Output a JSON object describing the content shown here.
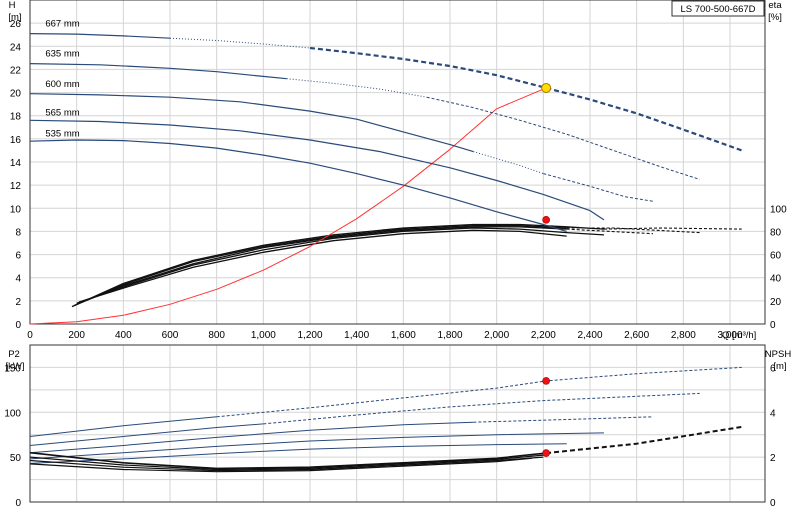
{
  "chart_data": [
    {
      "type": "line",
      "title": "LS 700-500-667D",
      "xlabel": "Q [m³/h]",
      "ylabel_left": [
        "H",
        "[m]"
      ],
      "ylabel_right": [
        "eta",
        "[%]"
      ],
      "xlim": [
        0,
        3150
      ],
      "ylim": [
        0,
        28
      ],
      "ylim_right": [
        0,
        280
      ],
      "grid": true,
      "x_ticks": [
        0,
        200,
        400,
        600,
        800,
        1000,
        1200,
        1400,
        1600,
        1800,
        2000,
        2200,
        2400,
        2600,
        2800,
        3000
      ],
      "x_tick_labels": [
        "0",
        "200",
        "400",
        "600",
        "800",
        "1,000",
        "1,200",
        "1,400",
        "1,600",
        "1,800",
        "2,000",
        "2,200",
        "2,400",
        "2,600",
        "2,800",
        "3,000"
      ],
      "y_ticks": [
        0,
        2,
        4,
        6,
        8,
        10,
        12,
        14,
        16,
        18,
        20,
        22,
        24,
        26
      ],
      "y_ticks_right": [
        0,
        20,
        40,
        60,
        80,
        100
      ],
      "head_curves": [
        {
          "name": "667 mm",
          "label_at": [
            10,
            25.7
          ],
          "solid": [
            [
              0,
              25.1
            ],
            [
              200,
              25.05
            ],
            [
              400,
              24.9
            ],
            [
              600,
              24.7
            ]
          ],
          "dotted": [
            [
              600,
              24.7
            ],
            [
              800,
              24.5
            ],
            [
              1000,
              24.2
            ],
            [
              1200,
              23.85
            ]
          ],
          "dashed": [
            [
              1200,
              23.85
            ],
            [
              1400,
              23.4
            ],
            [
              1600,
              22.9
            ],
            [
              1800,
              22.3
            ],
            [
              2000,
              21.5
            ],
            [
              2212,
              20.4
            ],
            [
              2400,
              19.4
            ],
            [
              2600,
              18.2
            ],
            [
              2800,
              16.8
            ],
            [
              3050,
              15.0
            ]
          ]
        },
        {
          "name": "635 mm",
          "label_at": [
            10,
            23.1
          ],
          "solid": [
            [
              0,
              22.5
            ],
            [
              300,
              22.4
            ],
            [
              600,
              22.1
            ],
            [
              800,
              21.8
            ],
            [
              1000,
              21.4
            ],
            [
              1100,
              21.2
            ]
          ],
          "dotted": [
            [
              1100,
              21.2
            ],
            [
              1300,
              20.8
            ],
            [
              1500,
              20.3
            ],
            [
              1700,
              19.6
            ]
          ],
          "dashed": [
            [
              1700,
              19.6
            ],
            [
              1900,
              18.7
            ],
            [
              2100,
              17.6
            ],
            [
              2300,
              16.4
            ],
            [
              2500,
              15.0
            ],
            [
              2700,
              13.6
            ],
            [
              2870,
              12.5
            ]
          ]
        },
        {
          "name": "600 mm",
          "label_at": [
            10,
            20.5
          ],
          "solid": [
            [
              0,
              19.9
            ],
            [
              300,
              19.8
            ],
            [
              600,
              19.6
            ],
            [
              900,
              19.2
            ],
            [
              1200,
              18.4
            ],
            [
              1400,
              17.7
            ],
            [
              1600,
              16.6
            ],
            [
              1800,
              15.5
            ],
            [
              1900,
              14.9
            ]
          ],
          "dotted": [
            [
              1900,
              14.9
            ],
            [
              2100,
              13.7
            ],
            [
              2200,
              13.0
            ]
          ],
          "dashed": [
            [
              2200,
              13.0
            ],
            [
              2400,
              11.9
            ],
            [
              2550,
              11.0
            ],
            [
              2670,
              10.6
            ]
          ]
        },
        {
          "name": "565 mm",
          "label_at": [
            10,
            18.0
          ],
          "solid": [
            [
              0,
              17.6
            ],
            [
              300,
              17.5
            ],
            [
              600,
              17.2
            ],
            [
              900,
              16.7
            ],
            [
              1200,
              15.9
            ],
            [
              1500,
              14.9
            ],
            [
              1800,
              13.5
            ],
            [
              2000,
              12.4
            ],
            [
              2200,
              11.2
            ],
            [
              2400,
              9.8
            ],
            [
              2460,
              9.0
            ]
          ],
          "dotted": [],
          "dashed": []
        },
        {
          "name": "535 mm",
          "label_at": [
            10,
            16.2
          ],
          "solid": [
            [
              0,
              15.8
            ],
            [
              200,
              15.9
            ],
            [
              400,
              15.85
            ],
            [
              600,
              15.6
            ],
            [
              800,
              15.2
            ],
            [
              1000,
              14.6
            ],
            [
              1200,
              13.9
            ],
            [
              1400,
              13.0
            ],
            [
              1600,
              12.0
            ],
            [
              1800,
              10.9
            ],
            [
              2000,
              9.7
            ],
            [
              2200,
              8.6
            ],
            [
              2300,
              8.0
            ]
          ],
          "dotted": [],
          "dashed": []
        }
      ],
      "eta_curves": [
        {
          "solid": [
            [
              180,
              15
            ],
            [
              400,
              35
            ],
            [
              700,
              55
            ],
            [
              1000,
              68
            ],
            [
              1300,
              77
            ],
            [
              1600,
              83
            ],
            [
              1900,
              86
            ],
            [
              2100,
              86
            ],
            [
              2300,
              84
            ],
            [
              2460,
              82
            ]
          ],
          "dashed": [
            [
              2460,
              82
            ],
            [
              2700,
              83
            ],
            [
              3050,
              82
            ]
          ]
        },
        {
          "solid": [
            [
              190,
              16
            ],
            [
              400,
              34
            ],
            [
              700,
              54
            ],
            [
              1000,
              67
            ],
            [
              1300,
              76
            ],
            [
              1600,
              82
            ],
            [
              1900,
              85
            ],
            [
              2100,
              85
            ],
            [
              2300,
              83
            ]
          ],
          "dashed": [
            [
              2300,
              83
            ],
            [
              2500,
              83
            ],
            [
              2870,
              79
            ]
          ]
        },
        {
          "solid": [
            [
              200,
              17
            ],
            [
              400,
              33
            ],
            [
              700,
              52
            ],
            [
              1000,
              66
            ],
            [
              1300,
              75
            ],
            [
              1600,
              81
            ],
            [
              1900,
              84
            ],
            [
              2100,
              84
            ],
            [
              2300,
              82
            ]
          ],
          "dashed": [
            [
              2300,
              82
            ],
            [
              2670,
              78
            ]
          ]
        },
        {
          "solid": [
            [
              200,
              18
            ],
            [
              400,
              32
            ],
            [
              700,
              51
            ],
            [
              1000,
              64
            ],
            [
              1300,
              74
            ],
            [
              1600,
              80
            ],
            [
              1900,
              83
            ],
            [
              2100,
              82
            ],
            [
              2300,
              79
            ],
            [
              2460,
              77
            ]
          ],
          "dashed": []
        },
        {
          "solid": [
            [
              210,
              19
            ],
            [
              400,
              31
            ],
            [
              700,
              49
            ],
            [
              1000,
              62
            ],
            [
              1300,
              72
            ],
            [
              1600,
              78
            ],
            [
              1900,
              81
            ],
            [
              2100,
              80
            ],
            [
              2300,
              76
            ]
          ],
          "dashed": []
        }
      ],
      "system_curve": [
        [
          0,
          0
        ],
        [
          200,
          0.2
        ],
        [
          400,
          0.75
        ],
        [
          600,
          1.7
        ],
        [
          800,
          3.0
        ],
        [
          1000,
          4.65
        ],
        [
          1200,
          6.7
        ],
        [
          1400,
          9.1
        ],
        [
          1600,
          11.9
        ],
        [
          1800,
          15.1
        ],
        [
          2000,
          18.6
        ],
        [
          2212,
          20.4
        ]
      ],
      "duty_point": {
        "q": 2212,
        "h": 20.4
      },
      "eta_point": {
        "q": 2212,
        "eta": 90
      }
    },
    {
      "type": "line",
      "ylabel_left": [
        "P2",
        "[kW]"
      ],
      "ylabel_right": [
        "NPSH",
        "[m]"
      ],
      "xlim": [
        0,
        3150
      ],
      "ylim": [
        0,
        175
      ],
      "ylim_right": [
        0,
        7
      ],
      "grid": true,
      "y_ticks": [
        0,
        50,
        100,
        150
      ],
      "y_ticks_right": [
        0,
        2,
        4,
        6
      ],
      "power_curves": [
        {
          "solid": [
            [
              0,
              73
            ],
            [
              400,
              85
            ],
            [
              800,
              95
            ]
          ],
          "dashed": [
            [
              800,
              95
            ],
            [
              1200,
              105
            ],
            [
              1600,
              116
            ],
            [
              2000,
              127
            ],
            [
              2212,
              135
            ],
            [
              2600,
              143
            ],
            [
              3050,
              150
            ]
          ]
        },
        {
          "solid": [
            [
              0,
              63
            ],
            [
              400,
              73
            ],
            [
              800,
              83
            ],
            [
              1000,
              87
            ]
          ],
          "dashed": [
            [
              1000,
              87
            ],
            [
              1400,
              97
            ],
            [
              1800,
              106
            ],
            [
              2200,
              113
            ],
            [
              2870,
              121
            ]
          ]
        },
        {
          "solid": [
            [
              0,
              55
            ],
            [
              400,
              63
            ],
            [
              800,
              72
            ],
            [
              1200,
              80
            ],
            [
              1600,
              86
            ],
            [
              1900,
              89
            ]
          ],
          "dashed": [
            [
              1900,
              89
            ],
            [
              2300,
              92
            ],
            [
              2670,
              95
            ]
          ]
        },
        {
          "solid": [
            [
              0,
              48
            ],
            [
              400,
              55
            ],
            [
              800,
              62
            ],
            [
              1200,
              68
            ],
            [
              1600,
              72
            ],
            [
              2000,
              75
            ],
            [
              2460,
              77
            ]
          ],
          "dashed": []
        },
        {
          "solid": [
            [
              0,
              43
            ],
            [
              400,
              48
            ],
            [
              800,
              54
            ],
            [
              1200,
              59
            ],
            [
              1600,
              62
            ],
            [
              2000,
              64
            ],
            [
              2300,
              65
            ]
          ],
          "dashed": []
        }
      ],
      "npsh_curves": [
        {
          "solid": [
            [
              0,
              2.2
            ],
            [
              400,
              1.75
            ],
            [
              800,
              1.5
            ],
            [
              1200,
              1.55
            ],
            [
              1600,
              1.75
            ],
            [
              2000,
              1.95
            ],
            [
              2212,
              2.18
            ]
          ],
          "dashed": [
            [
              2212,
              2.18
            ],
            [
              2600,
              2.6
            ],
            [
              3050,
              3.35
            ]
          ]
        },
        {
          "solid": [
            [
              0,
              2.0
            ],
            [
              400,
              1.65
            ],
            [
              800,
              1.45
            ],
            [
              1200,
              1.5
            ],
            [
              1600,
              1.7
            ],
            [
              2000,
              1.9
            ],
            [
              2212,
              2.1
            ]
          ],
          "dashed": []
        },
        {
          "solid": [
            [
              0,
              1.85
            ],
            [
              400,
              1.55
            ],
            [
              800,
              1.4
            ],
            [
              1200,
              1.45
            ],
            [
              1600,
              1.65
            ],
            [
              2000,
              1.85
            ],
            [
              2200,
              2.0
            ]
          ],
          "dashed": []
        },
        {
          "solid": [
            [
              0,
              1.7
            ],
            [
              400,
              1.45
            ],
            [
              800,
              1.35
            ],
            [
              1200,
              1.4
            ],
            [
              1600,
              1.6
            ],
            [
              2000,
              1.8
            ],
            [
              2150,
              1.95
            ]
          ],
          "dashed": []
        }
      ],
      "power_point": {
        "q": 2212,
        "p": 135
      },
      "npsh_point": {
        "q": 2212,
        "npsh": 2.18
      }
    }
  ]
}
